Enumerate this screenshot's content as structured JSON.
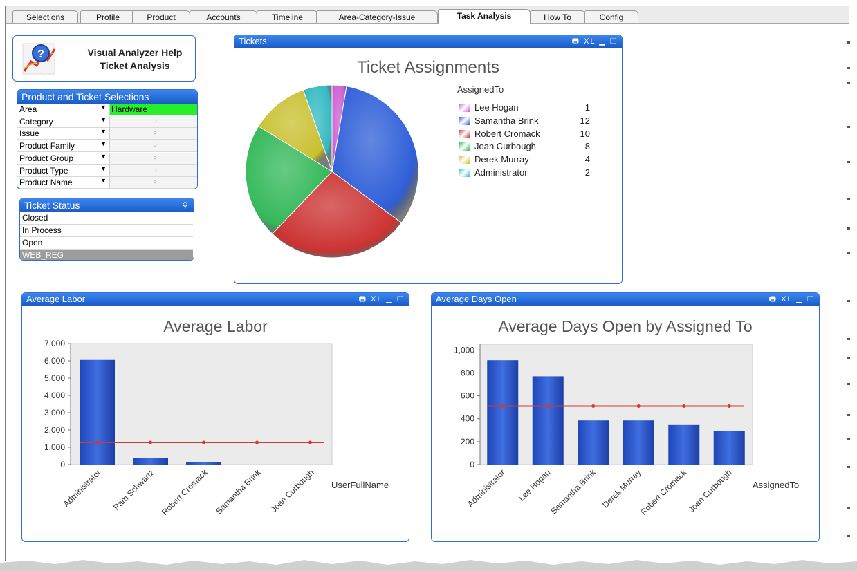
{
  "tabs": [
    "Selections",
    "Profile",
    "Product",
    "Accounts",
    "Timeline",
    "Area-Category-Issue",
    "Task Analysis",
    "How To",
    "Config"
  ],
  "active_tab": "Task Analysis",
  "help": {
    "line1": "Visual Analyzer Help",
    "line2": "Ticket Analysis"
  },
  "selections": {
    "title": "Product and Ticket Selections",
    "rows": [
      {
        "label": "Area",
        "value": "Hardware",
        "selected": true
      },
      {
        "label": "Category",
        "value": "○"
      },
      {
        "label": "Issue",
        "value": "○"
      },
      {
        "label": "Product Family",
        "value": "○"
      },
      {
        "label": "Product Group",
        "value": "○"
      },
      {
        "label": "Product Type",
        "value": "○"
      },
      {
        "label": "Product Name",
        "value": "○"
      }
    ]
  },
  "status": {
    "title": "Ticket Status",
    "items": [
      {
        "label": "Closed"
      },
      {
        "label": "In Process"
      },
      {
        "label": "Open"
      },
      {
        "label": "WEB_REG",
        "excluded": true
      }
    ]
  },
  "panel_icons": "🖶 XL ▁ ▢",
  "tickets_panel": {
    "title": "Tickets"
  },
  "labor_panel": {
    "title": "Average Labor"
  },
  "days_panel": {
    "title": "Average Days Open"
  },
  "colors": {
    "accent": "#1a5cc8",
    "pie": [
      "#cc5fd3",
      "#2f5fd8",
      "#cc3333",
      "#34b85a",
      "#c9c030",
      "#35b9c2"
    ],
    "bar": "#2f5fd0",
    "refline": "#d23a3a",
    "selected_green": "#28f028"
  },
  "chart_data": [
    {
      "type": "pie",
      "title": "Ticket Assignments",
      "legend_title": "AssignedTo",
      "legend_position": "right",
      "labels": [
        "Lee Hogan",
        "Samantha Brink",
        "Robert Cromack",
        "Joan Curbough",
        "Derek Murray",
        "Administrator"
      ],
      "values": [
        1,
        12,
        10,
        8,
        4,
        2
      ]
    },
    {
      "type": "bar",
      "title": "Average Labor",
      "xlabel": "UserFullName",
      "categories": [
        "Administrator",
        "Pam Schwartz",
        "Robert Cromack",
        "Samantha Brink",
        "Joan Curbough"
      ],
      "values": [
        6050,
        380,
        160,
        0,
        0
      ],
      "reference_line": 1280,
      "ylim": [
        0,
        7000
      ],
      "yticks": [
        0,
        1000,
        2000,
        3000,
        4000,
        5000,
        6000,
        7000
      ],
      "ytick_labels": [
        "0",
        "1,000",
        "2,000",
        "3,000",
        "4,000",
        "5,000",
        "6,000",
        "7,000"
      ]
    },
    {
      "type": "bar",
      "title": "Average Days Open by Assigned To",
      "xlabel": "AssignedTo",
      "categories": [
        "Administrator",
        "Lee Hogan",
        "Samantha Brink",
        "Derek Murray",
        "Robert Cromack",
        "Joan Curbough"
      ],
      "values": [
        910,
        770,
        385,
        385,
        345,
        290
      ],
      "reference_line": 510,
      "ylim": [
        0,
        1050
      ],
      "yticks": [
        0,
        200,
        400,
        600,
        800,
        1000
      ],
      "ytick_labels": [
        "0",
        "200",
        "400",
        "600",
        "800",
        "1,000"
      ]
    }
  ]
}
